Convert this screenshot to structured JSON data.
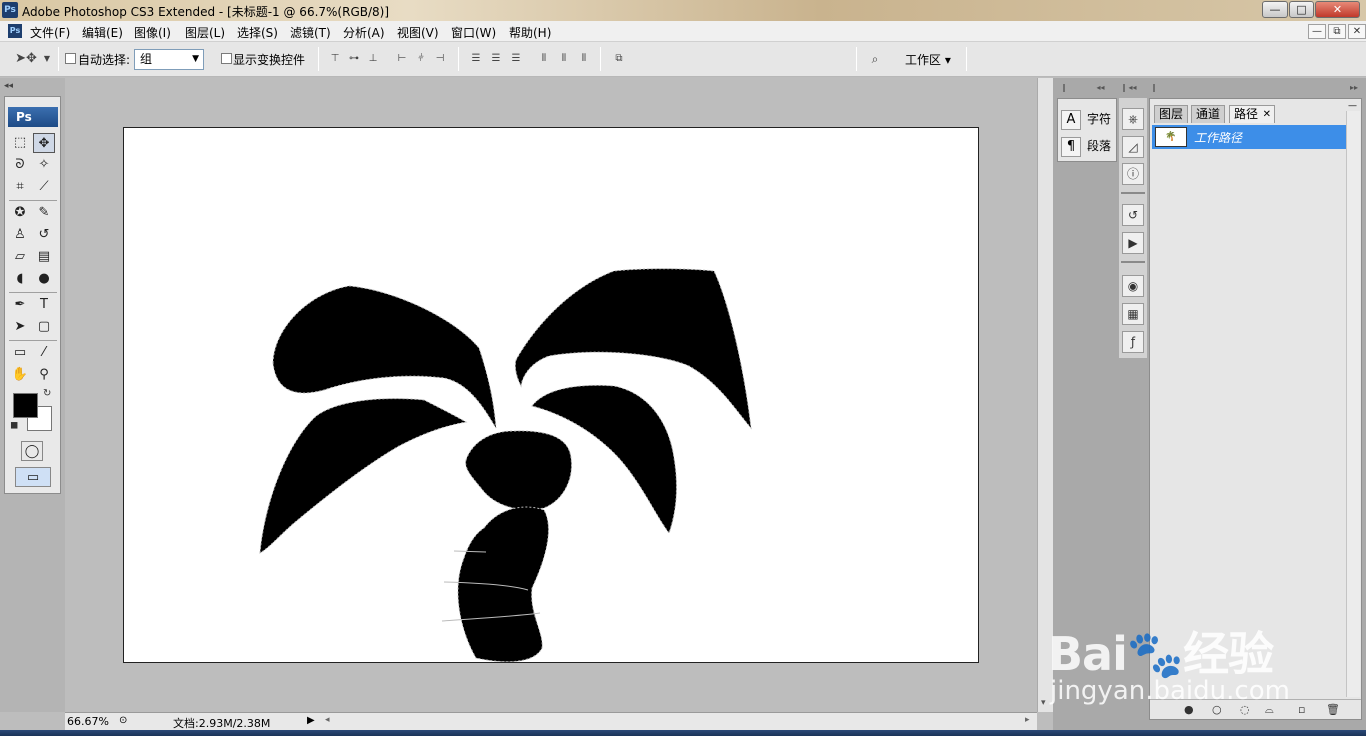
{
  "window": {
    "title": "Adobe Photoshop CS3 Extended - [未标题-1 @ 66.7%(RGB/8)]",
    "controls": {
      "minimize": "—",
      "maximize": "□",
      "close": "✕"
    },
    "app_icon": "Ps"
  },
  "menu": {
    "items": [
      "文件(F)",
      "编辑(E)",
      "图像(I)",
      "图层(L)",
      "选择(S)",
      "滤镜(T)",
      "分析(A)",
      "视图(V)",
      "窗口(W)",
      "帮助(H)"
    ],
    "doc_controls": {
      "minimize": "—",
      "restore": "⧉",
      "close": "✕"
    }
  },
  "options": {
    "auto_select_label": "自动选择:",
    "auto_select_value": "组",
    "show_transform_label": "显示变换控件",
    "workspace_label": "工作区 ▾"
  },
  "toolbox": {
    "badge": "Ps",
    "tools": [
      {
        "name": "marquee-tool",
        "glyph": "⬚"
      },
      {
        "name": "move-tool",
        "glyph": "✥",
        "active": true
      },
      {
        "name": "lasso-tool",
        "glyph": "ᘐ"
      },
      {
        "name": "magic-wand-tool",
        "glyph": "✧"
      },
      {
        "name": "crop-tool",
        "glyph": "⌗"
      },
      {
        "name": "slice-tool",
        "glyph": "⟋"
      },
      {
        "name": "healing-brush-tool",
        "glyph": "✪"
      },
      {
        "name": "brush-tool",
        "glyph": "✎"
      },
      {
        "name": "clone-stamp-tool",
        "glyph": "♙"
      },
      {
        "name": "history-brush-tool",
        "glyph": "↺"
      },
      {
        "name": "eraser-tool",
        "glyph": "▱"
      },
      {
        "name": "gradient-tool",
        "glyph": "▤"
      },
      {
        "name": "blur-tool",
        "glyph": "◖"
      },
      {
        "name": "dodge-tool",
        "glyph": "●"
      },
      {
        "name": "pen-tool",
        "glyph": "✒"
      },
      {
        "name": "type-tool",
        "glyph": "T"
      },
      {
        "name": "path-selection-tool",
        "glyph": "➤"
      },
      {
        "name": "shape-tool",
        "glyph": "▢"
      },
      {
        "name": "notes-tool",
        "glyph": "▭"
      },
      {
        "name": "eyedropper-tool",
        "glyph": "⁄"
      },
      {
        "name": "hand-tool",
        "glyph": "✋"
      },
      {
        "name": "zoom-tool",
        "glyph": "⚲"
      }
    ],
    "foreground_color": "#000000",
    "background_color": "#ffffff"
  },
  "status": {
    "zoom": "66.67%",
    "doc_info": "文档:2.93M/2.38M"
  },
  "dock": {
    "character_label": "字符",
    "paragraph_label": "段落"
  },
  "layers_panel": {
    "tabs": [
      "图层",
      "通道",
      "路径"
    ],
    "active_tab": "路径",
    "path_name": "工作路径"
  },
  "watermark": {
    "brand": "Bai",
    "brand_suffix": "经验",
    "site": "jingyan.baidu.com"
  }
}
